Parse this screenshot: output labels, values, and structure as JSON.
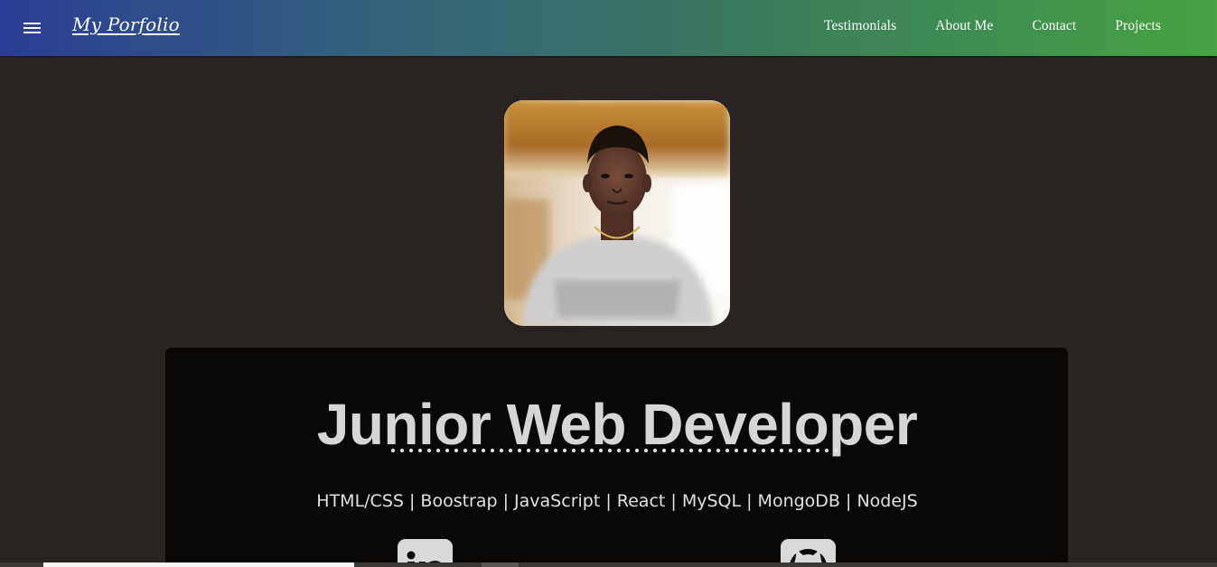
{
  "navbar": {
    "brand": "My Porfolio",
    "menu_icon": "hamburger-menu-icon",
    "links": [
      "Testimonials",
      "About Me",
      "Contact",
      "Projects"
    ],
    "gradient": [
      "#2a3e95",
      "#46a443"
    ]
  },
  "hero": {
    "title": "Junior Web Developer",
    "skills": "HTML/CSS | Boostrap | JavaScript | React | MySQL | MongoDB | NodeJS",
    "social": [
      {
        "icon": "linkedin-icon"
      },
      {
        "icon": "github-icon"
      }
    ]
  },
  "colors": {
    "background": "#292421",
    "card": "#090807",
    "title": "#d6d6d6"
  }
}
